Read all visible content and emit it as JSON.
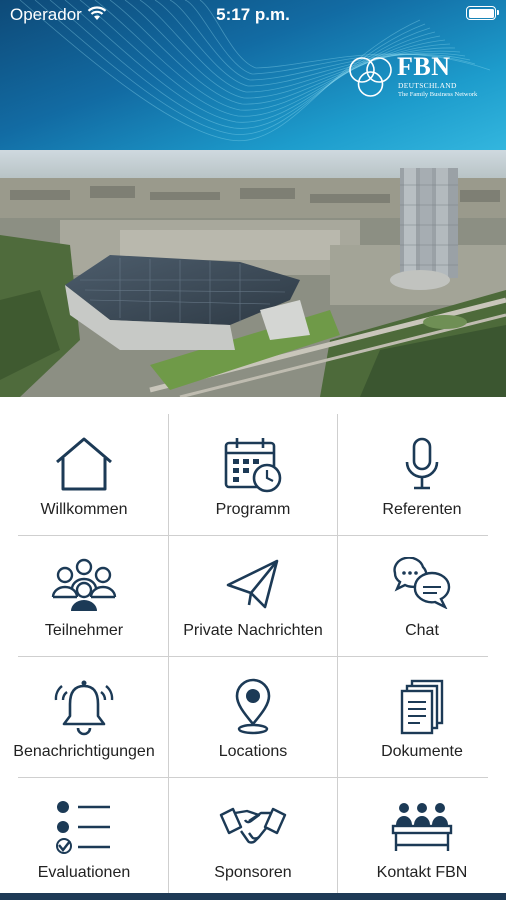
{
  "status_bar": {
    "carrier": "Operador",
    "time": "5:17 p.m.",
    "wifi_icon": "wifi-icon",
    "battery_icon": "battery-icon"
  },
  "header": {
    "logo": {
      "brand": "FBN",
      "subtitle": "DEUTSCHLAND",
      "tagline": "The Family Business Network"
    },
    "colors": {
      "primary": "#1d5a86",
      "accent": "#1d9ccc"
    }
  },
  "hero_image": {
    "alt": "aerial-city-photo"
  },
  "menu": [
    {
      "label": "Willkommen",
      "icon": "home-icon"
    },
    {
      "label": "Programm",
      "icon": "calendar-clock-icon"
    },
    {
      "label": "Referenten",
      "icon": "microphone-icon"
    },
    {
      "label": "Teilnehmer",
      "icon": "group-icon"
    },
    {
      "label": "Private Nachrichten",
      "icon": "paper-plane-icon"
    },
    {
      "label": "Chat",
      "icon": "chat-bubbles-icon"
    },
    {
      "label": "Benachrichtigungen",
      "icon": "bell-icon"
    },
    {
      "label": "Locations",
      "icon": "map-pin-icon"
    },
    {
      "label": "Dokumente",
      "icon": "documents-icon"
    },
    {
      "label": "Evaluationen",
      "icon": "checklist-icon"
    },
    {
      "label": "Sponsoren",
      "icon": "handshake-icon"
    },
    {
      "label": "Kontakt FBN",
      "icon": "team-table-icon"
    }
  ]
}
